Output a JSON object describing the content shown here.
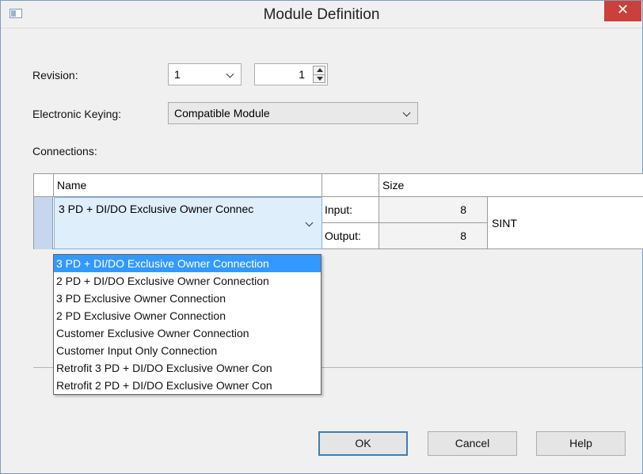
{
  "window": {
    "title": "Module Definition",
    "close_glyph": "✕"
  },
  "form": {
    "revision_label": "Revision:",
    "revision_major": "1",
    "revision_minor": "1",
    "keying_label": "Electronic Keying:",
    "keying_value": "Compatible Module",
    "connections_label": "Connections:"
  },
  "grid": {
    "headers": {
      "name": "Name",
      "blank": "",
      "size": "Size"
    },
    "row": {
      "name": "3 PD + DI/DO Exclusive Owner Connec",
      "input_label": "Input:",
      "input_size": "8",
      "output_label": "Output:",
      "output_size": "8",
      "type": "SINT"
    }
  },
  "dropdown": {
    "options": [
      "3 PD + DI/DO Exclusive Owner Connection",
      "2 PD + DI/DO Exclusive Owner Connection",
      "3 PD Exclusive Owner Connection",
      "2 PD Exclusive Owner Connection",
      "Customer Exclusive Owner Connection",
      "Customer Input Only Connection",
      "Retrofit 3 PD + DI/DO Exclusive Owner Con",
      "Retrofit 2 PD + DI/DO Exclusive Owner Con"
    ],
    "selected_index": 0
  },
  "buttons": {
    "ok": "OK",
    "cancel": "Cancel",
    "help": "Help"
  },
  "colors": {
    "close_bg": "#c9413a",
    "selection": "#3399ff",
    "focus_border": "#3c7fb1"
  }
}
